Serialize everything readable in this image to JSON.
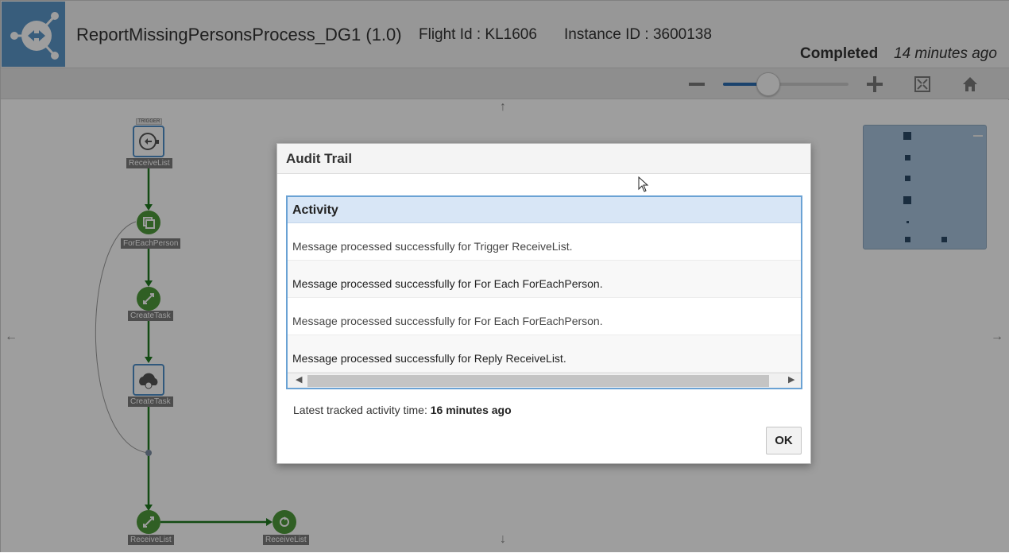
{
  "header": {
    "title": "ReportMissingPersonsProcess_DG1 (1.0)",
    "flight": "Flight Id : KL1606",
    "instance": "Instance ID : 3600138",
    "status": "Completed",
    "status_time": "14 minutes ago"
  },
  "toolbar": {
    "zoom_level": 0.36,
    "icons": [
      "zoom-out-icon",
      "zoom-in-icon",
      "fit-to-screen-icon",
      "home-icon"
    ]
  },
  "diagram": {
    "trigger_tag": "TRIGGER",
    "nodes": [
      {
        "label": "ReceiveList",
        "icon": "trigger-icon"
      },
      {
        "label": "ForEachPerson",
        "icon": "for-each-icon"
      },
      {
        "label": "CreateTask",
        "icon": "invoke-icon"
      },
      {
        "label": "CreateTask",
        "icon": "cloud-icon"
      },
      {
        "label": "ReceiveList",
        "icon": "reply-icon"
      },
      {
        "label": "ReceiveList",
        "icon": "end-icon"
      }
    ],
    "arrows": {
      "up": "↑",
      "down": "↓",
      "left": "←",
      "right": "→"
    }
  },
  "dialog": {
    "title": "Audit Trail",
    "column_header": "Activity",
    "rows": [
      "Message processed successfully for Trigger ReceiveList.",
      "Message processed successfully for For Each ForEachPerson.",
      "Message processed successfully for For Each ForEachPerson.",
      "Message processed successfully for Reply ReceiveList."
    ],
    "latest_label": "Latest tracked activity time:",
    "latest_value": "16 minutes ago",
    "ok_label": "OK"
  },
  "colors": {
    "accent_blue": "#2c6cb0",
    "node_green": "#4e9a3a",
    "flow_green": "#1f7a1f",
    "logo_blue": "#5b97c9"
  }
}
